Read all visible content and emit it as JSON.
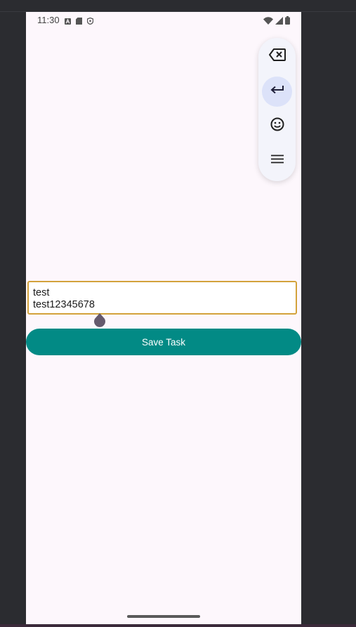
{
  "status_bar": {
    "time": "11:30",
    "icons_left": [
      "font-a-icon",
      "sd-card-icon",
      "shield-icon"
    ],
    "icons_right": [
      "wifi-icon",
      "signal-icon",
      "battery-icon"
    ]
  },
  "keyboard_toolbar": {
    "buttons": [
      {
        "icon": "backspace-icon"
      },
      {
        "icon": "enter-icon",
        "active": true
      },
      {
        "icon": "emoji-icon"
      },
      {
        "icon": "menu-icon"
      }
    ]
  },
  "task_input": {
    "lines": [
      "test",
      "test12345678"
    ]
  },
  "save_button": {
    "label": "Save Task"
  },
  "colors": {
    "accent": "#028a85",
    "input_border": "#d3a23b",
    "background": "#fdf7fc",
    "toolbar_active": "#dce2f9"
  }
}
